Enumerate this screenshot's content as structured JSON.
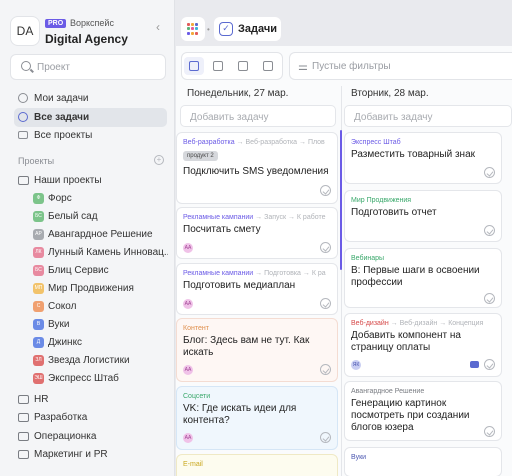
{
  "workspace": {
    "avatar": "DA",
    "plan": "PRO",
    "label": "Воркспейс",
    "name": "Digital Agency"
  },
  "search": {
    "placeholder": "Проект"
  },
  "nav": [
    {
      "label": "Мои задачи"
    },
    {
      "label": "Все задачи",
      "active": true
    },
    {
      "label": "Все проекты"
    }
  ],
  "projects_header": "Проекты",
  "folders": [
    {
      "label": "Наши проекты"
    },
    {
      "label": "HR"
    },
    {
      "label": "Разработка"
    },
    {
      "label": "Операционка"
    },
    {
      "label": "Маркетинг и PR"
    }
  ],
  "projects": [
    {
      "label": "Форс",
      "initials": "Ф",
      "color": "#7cc48a"
    },
    {
      "label": "Белый сад",
      "initials": "БС",
      "color": "#7cc48a"
    },
    {
      "label": "Авангардное Решение",
      "initials": "АР",
      "color": "#a8abb0"
    },
    {
      "label": "Лунный Камень Инновац...",
      "initials": "ЛК",
      "color": "#e88aa0"
    },
    {
      "label": "Блиц Сервис",
      "initials": "БС",
      "color": "#e88aa0"
    },
    {
      "label": "Мир Продвижения",
      "initials": "МП",
      "color": "#f2c36b"
    },
    {
      "label": "Сокол",
      "initials": "С",
      "color": "#f0a070"
    },
    {
      "label": "Вуки",
      "initials": "В",
      "color": "#6b8be6"
    },
    {
      "label": "Джинкс",
      "initials": "Д",
      "color": "#6b8be6"
    },
    {
      "label": "Звезда Логистики",
      "initials": "ЗЛ",
      "color": "#e07070"
    },
    {
      "label": "Экспресс Штаб",
      "initials": "ЭШ",
      "color": "#e07070"
    }
  ],
  "topbar": {
    "tab_label": "Задачи"
  },
  "filter": {
    "placeholder": "Пустые фильтры"
  },
  "columns": [
    {
      "header": "Понедельник, 27 мар.",
      "add_placeholder": "Добавить задачу"
    },
    {
      "header": "Вторник, 28 мар.",
      "add_placeholder": "Добавить задачу"
    }
  ],
  "cards_col1": [
    {
      "crumb": [
        "Веб-разработка",
        "Веб-разработка",
        "Плов"
      ],
      "tag": "продукт 2",
      "title": "Подключить SMS уведомления"
    },
    {
      "crumb": [
        "Рекламные кампании",
        "Запуск",
        "К работе"
      ],
      "title": "Посчитать смету",
      "avatar": "АА"
    },
    {
      "crumb": [
        "Рекламные кампании",
        "Подготовка",
        "К ра"
      ],
      "title": "Подготовить медиаплан",
      "avatar": "АА"
    },
    {
      "crumb": [
        "Контент"
      ],
      "title": "Блог: Здесь вам не тут. Как искать",
      "avatar": "АА"
    },
    {
      "crumb": [
        "Соцсети"
      ],
      "title": "VK: Где искать идеи для контента?",
      "avatar": "АА"
    },
    {
      "crumb": [
        "E-mail"
      ]
    }
  ],
  "cards_col2": [
    {
      "crumb": [
        "Экспресс Штаб"
      ],
      "title": "Разместить товарный знак"
    },
    {
      "crumb": [
        "Мир Продвижения"
      ],
      "title": "Подготовить отчет"
    },
    {
      "crumb": [
        "Вебинары"
      ],
      "title": "В: Первые шаги в освоении профессии"
    },
    {
      "crumb": [
        "Веб-дизайн",
        "Веб-дизайн",
        "Концепция"
      ],
      "title": "Добавить компонент на страницу оплаты",
      "avatar": "ЯК"
    },
    {
      "crumb": [
        "Авангардное Решение"
      ],
      "title": "Генерацию картинок посмотреть при создании блогов юзера"
    },
    {
      "crumb": [
        "Вуки"
      ]
    }
  ]
}
